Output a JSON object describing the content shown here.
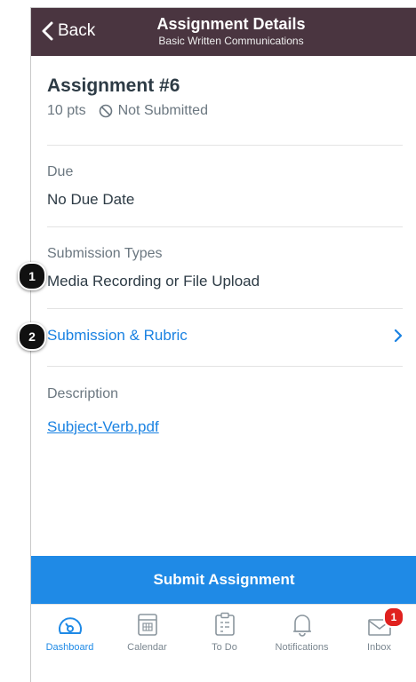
{
  "nav": {
    "back_label": "Back",
    "title": "Assignment Details",
    "subtitle": "Basic Written Communications"
  },
  "assignment": {
    "title": "Assignment #6",
    "points": "10 pts",
    "status": "Not Submitted"
  },
  "due": {
    "label": "Due",
    "value": "No Due Date"
  },
  "submission_types": {
    "label": "Submission Types",
    "value": "Media Recording or File Upload"
  },
  "submission_rubric": {
    "label": "Submission & Rubric"
  },
  "description": {
    "label": "Description",
    "file_link": "Subject-Verb.pdf"
  },
  "submit_button": "Submit Assignment",
  "tabs": [
    {
      "label": "Dashboard",
      "icon": "dashboard-icon",
      "active": true
    },
    {
      "label": "Calendar",
      "icon": "calendar-icon",
      "active": false
    },
    {
      "label": "To Do",
      "icon": "todo-icon",
      "active": false
    },
    {
      "label": "Notifications",
      "icon": "bell-icon",
      "active": false
    },
    {
      "label": "Inbox",
      "icon": "inbox-icon",
      "active": false,
      "badge": "1"
    }
  ],
  "callouts": [
    "1",
    "2"
  ],
  "colors": {
    "nav_bg": "#4a3540",
    "link": "#1a82e2",
    "submit_bg": "#1f8ae6",
    "badge": "#e0211f"
  }
}
